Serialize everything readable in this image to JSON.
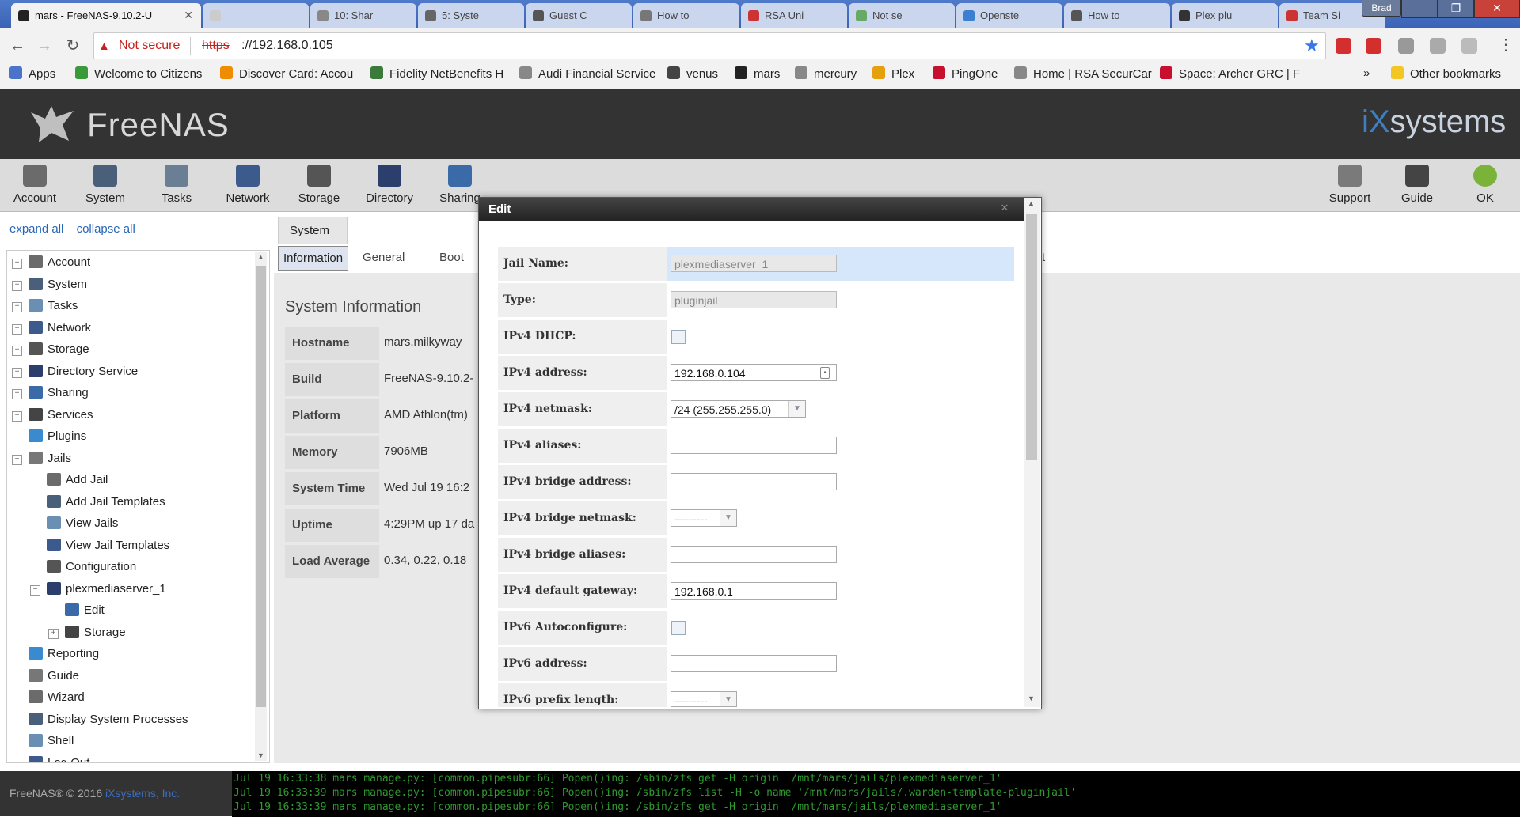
{
  "browser": {
    "tabs": [
      {
        "title": "mars - FreeNAS-9.10.2-U",
        "active": true
      },
      {
        "title": "",
        "active": false
      },
      {
        "title": "10: Shar",
        "active": false
      },
      {
        "title": "5: Syste",
        "active": false
      },
      {
        "title": "Guest C",
        "active": false
      },
      {
        "title": "How to",
        "active": false
      },
      {
        "title": "RSA Uni",
        "active": false
      },
      {
        "title": "Not se",
        "active": false
      },
      {
        "title": "Openste",
        "active": false
      },
      {
        "title": "How to",
        "active": false
      },
      {
        "title": "Plex plu",
        "active": false
      },
      {
        "title": "Team Si",
        "active": false
      }
    ],
    "profile": "Brad",
    "security_label": "Not secure",
    "url_scheme": "https",
    "url_rest": "://192.168.0.105",
    "bookmarks": [
      {
        "label": "Apps",
        "color": "#4a73c9"
      },
      {
        "label": "Welcome to Citizens",
        "color": "#3a9a3a"
      },
      {
        "label": "Discover Card: Accou",
        "color": "#f08c00"
      },
      {
        "label": "Fidelity NetBenefits H",
        "color": "#3a7a3a"
      },
      {
        "label": "Audi Financial Service",
        "color": "#888888"
      },
      {
        "label": "venus",
        "color": "#444444"
      },
      {
        "label": "mars",
        "color": "#222222"
      },
      {
        "label": "mercury",
        "color": "#888888"
      },
      {
        "label": "Plex",
        "color": "#e5a00d"
      },
      {
        "label": "PingOne",
        "color": "#c8102e"
      },
      {
        "label": "Home | RSA SecurCar",
        "color": "#888888"
      },
      {
        "label": "Space: Archer GRC | F",
        "color": "#c8102e"
      }
    ],
    "bookmarks_overflow": "»",
    "other_bookmarks": "Other bookmarks"
  },
  "header": {
    "logo": "FreeNAS",
    "vendor_logo_prefix": "iX",
    "vendor_logo_suffix": "systems"
  },
  "topmenu": {
    "left": [
      "Account",
      "System",
      "Tasks",
      "Network",
      "Storage",
      "Directory",
      "Sharing"
    ],
    "right": [
      "Support",
      "Guide",
      "OK"
    ]
  },
  "tree": {
    "expand_all": "expand all",
    "collapse_all": "collapse all",
    "items": [
      {
        "label": "Account",
        "level": 0,
        "toggle": "+"
      },
      {
        "label": "System",
        "level": 0,
        "toggle": "+"
      },
      {
        "label": "Tasks",
        "level": 0,
        "toggle": "+"
      },
      {
        "label": "Network",
        "level": 0,
        "toggle": "+"
      },
      {
        "label": "Storage",
        "level": 0,
        "toggle": "+"
      },
      {
        "label": "Directory Service",
        "level": 0,
        "toggle": "+"
      },
      {
        "label": "Sharing",
        "level": 0,
        "toggle": "+"
      },
      {
        "label": "Services",
        "level": 0,
        "toggle": "+"
      },
      {
        "label": "Plugins",
        "level": 0,
        "toggle": ""
      },
      {
        "label": "Jails",
        "level": 0,
        "toggle": "-"
      },
      {
        "label": "Add Jail",
        "level": 1,
        "toggle": ""
      },
      {
        "label": "Add Jail Templates",
        "level": 1,
        "toggle": ""
      },
      {
        "label": "View Jails",
        "level": 1,
        "toggle": ""
      },
      {
        "label": "View Jail Templates",
        "level": 1,
        "toggle": ""
      },
      {
        "label": "Configuration",
        "level": 1,
        "toggle": ""
      },
      {
        "label": "plexmediaserver_1",
        "level": 1,
        "toggle": "-"
      },
      {
        "label": "Edit",
        "level": 2,
        "toggle": ""
      },
      {
        "label": "Storage",
        "level": 2,
        "toggle": "+"
      },
      {
        "label": "Reporting",
        "level": 0,
        "toggle": ""
      },
      {
        "label": "Guide",
        "level": 0,
        "toggle": ""
      },
      {
        "label": "Wizard",
        "level": 0,
        "toggle": ""
      },
      {
        "label": "Display System Processes",
        "level": 0,
        "toggle": ""
      },
      {
        "label": "Shell",
        "level": 0,
        "toggle": ""
      },
      {
        "label": "Log Out",
        "level": 0,
        "toggle": ""
      }
    ]
  },
  "main": {
    "tab": "System",
    "subtabs": [
      "Information",
      "General",
      "Boot"
    ],
    "subtab_partial": "rt",
    "title": "System Information",
    "rows": [
      {
        "label": "Hostname",
        "value": "mars.milkyway"
      },
      {
        "label": "Build",
        "value": "FreeNAS-9.10.2-"
      },
      {
        "label": "Platform",
        "value": "AMD Athlon(tm)"
      },
      {
        "label": "Memory",
        "value": "7906MB"
      },
      {
        "label": "System Time",
        "value": "Wed Jul 19 16:2"
      },
      {
        "label": "Uptime",
        "value": "4:29PM up 17 da"
      },
      {
        "label": "Load Average",
        "value": "0.34, 0.22, 0.18"
      }
    ]
  },
  "modal": {
    "title": "Edit",
    "jail_name_label": "Jail Name:",
    "jail_name_value": "plexmediaserver_1",
    "type_label": "Type:",
    "type_value": "pluginjail",
    "ipv4_dhcp_label": "IPv4 DHCP:",
    "ipv4_address_label": "IPv4 address:",
    "ipv4_address_value": "192.168.0.104",
    "ipv4_netmask_label": "IPv4 netmask:",
    "ipv4_netmask_value": "/24 (255.255.255.0)",
    "ipv4_aliases_label": "IPv4 aliases:",
    "ipv4_bridge_address_label": "IPv4 bridge address:",
    "ipv4_bridge_netmask_label": "IPv4 bridge netmask:",
    "ipv4_bridge_netmask_value": "---------",
    "ipv4_bridge_aliases_label": "IPv4 bridge aliases:",
    "ipv4_gateway_label": "IPv4 default gateway:",
    "ipv4_gateway_value": "192.168.0.1",
    "ipv6_autoconf_label": "IPv6 Autoconfigure:",
    "ipv6_address_label": "IPv6 address:",
    "ipv6_prefix_label": "IPv6 prefix length:",
    "ipv6_prefix_value": "---------"
  },
  "footer": {
    "copyright": "FreeNAS® © 2016",
    "vendor": "iXsystems, Inc.",
    "console": [
      "Jul 19 16:33:38 mars manage.py: [common.pipesubr:66] Popen()ing: /sbin/zfs get -H origin '/mnt/mars/jails/plexmediaserver_1'",
      "Jul 19 16:33:39 mars manage.py: [common.pipesubr:66] Popen()ing: /sbin/zfs list -H -o name '/mnt/mars/jails/.warden-template-pluginjail'",
      "Jul 19 16:33:39 mars manage.py: [common.pipesubr:66] Popen()ing: /sbin/zfs get -H origin '/mnt/mars/jails/plexmediaserver_1'"
    ]
  },
  "colors": {
    "header_bg": "#333333",
    "accent_blue": "#2a66b8",
    "console_green": "#2f9a2f",
    "not_secure_red": "#c5221f"
  }
}
